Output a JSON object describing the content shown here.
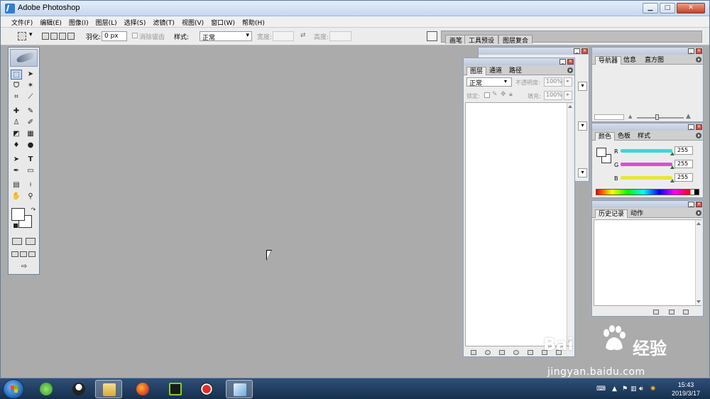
{
  "window": {
    "title": "Adobe Photoshop"
  },
  "menu": [
    "文件(F)",
    "编辑(E)",
    "图像(I)",
    "图层(L)",
    "选择(S)",
    "滤镜(T)",
    "视图(V)",
    "窗口(W)",
    "帮助(H)"
  ],
  "options": {
    "feather_label": "羽化:",
    "feather_value": "0 px",
    "antialias_label": "消除锯齿",
    "style_label": "样式:",
    "style_value": "正常",
    "width_label": "宽度:",
    "height_label": "高度:"
  },
  "palette_well": {
    "tabs": [
      "画笔",
      "工具预设",
      "图层复合"
    ]
  },
  "layers_panel": {
    "tabs": [
      "图层",
      "通道",
      "路径"
    ],
    "blend_mode": "正常",
    "opacity_label": "不透明度:",
    "opacity_value": "100%",
    "lock_label": "锁定:",
    "fill_label": "填充:",
    "fill_value": "100%"
  },
  "navigator_panel": {
    "tabs": [
      "导航器",
      "信息",
      "直方图"
    ]
  },
  "color_panel": {
    "tabs": [
      "颜色",
      "色板",
      "样式"
    ],
    "channels": [
      {
        "label": "R",
        "value": "255",
        "color": "#3fd6d6"
      },
      {
        "label": "G",
        "value": "255",
        "color": "#d84fd8"
      },
      {
        "label": "B",
        "value": "255",
        "color": "#e6e63a"
      }
    ]
  },
  "history_panel": {
    "tabs": [
      "历史记录",
      "动作"
    ]
  },
  "taskbar": {
    "time": "15:43",
    "date": "2019/3/17"
  },
  "watermark": {
    "brand_left": "Bai",
    "brand_right": "经验",
    "url": "jingyan.baidu.com"
  }
}
